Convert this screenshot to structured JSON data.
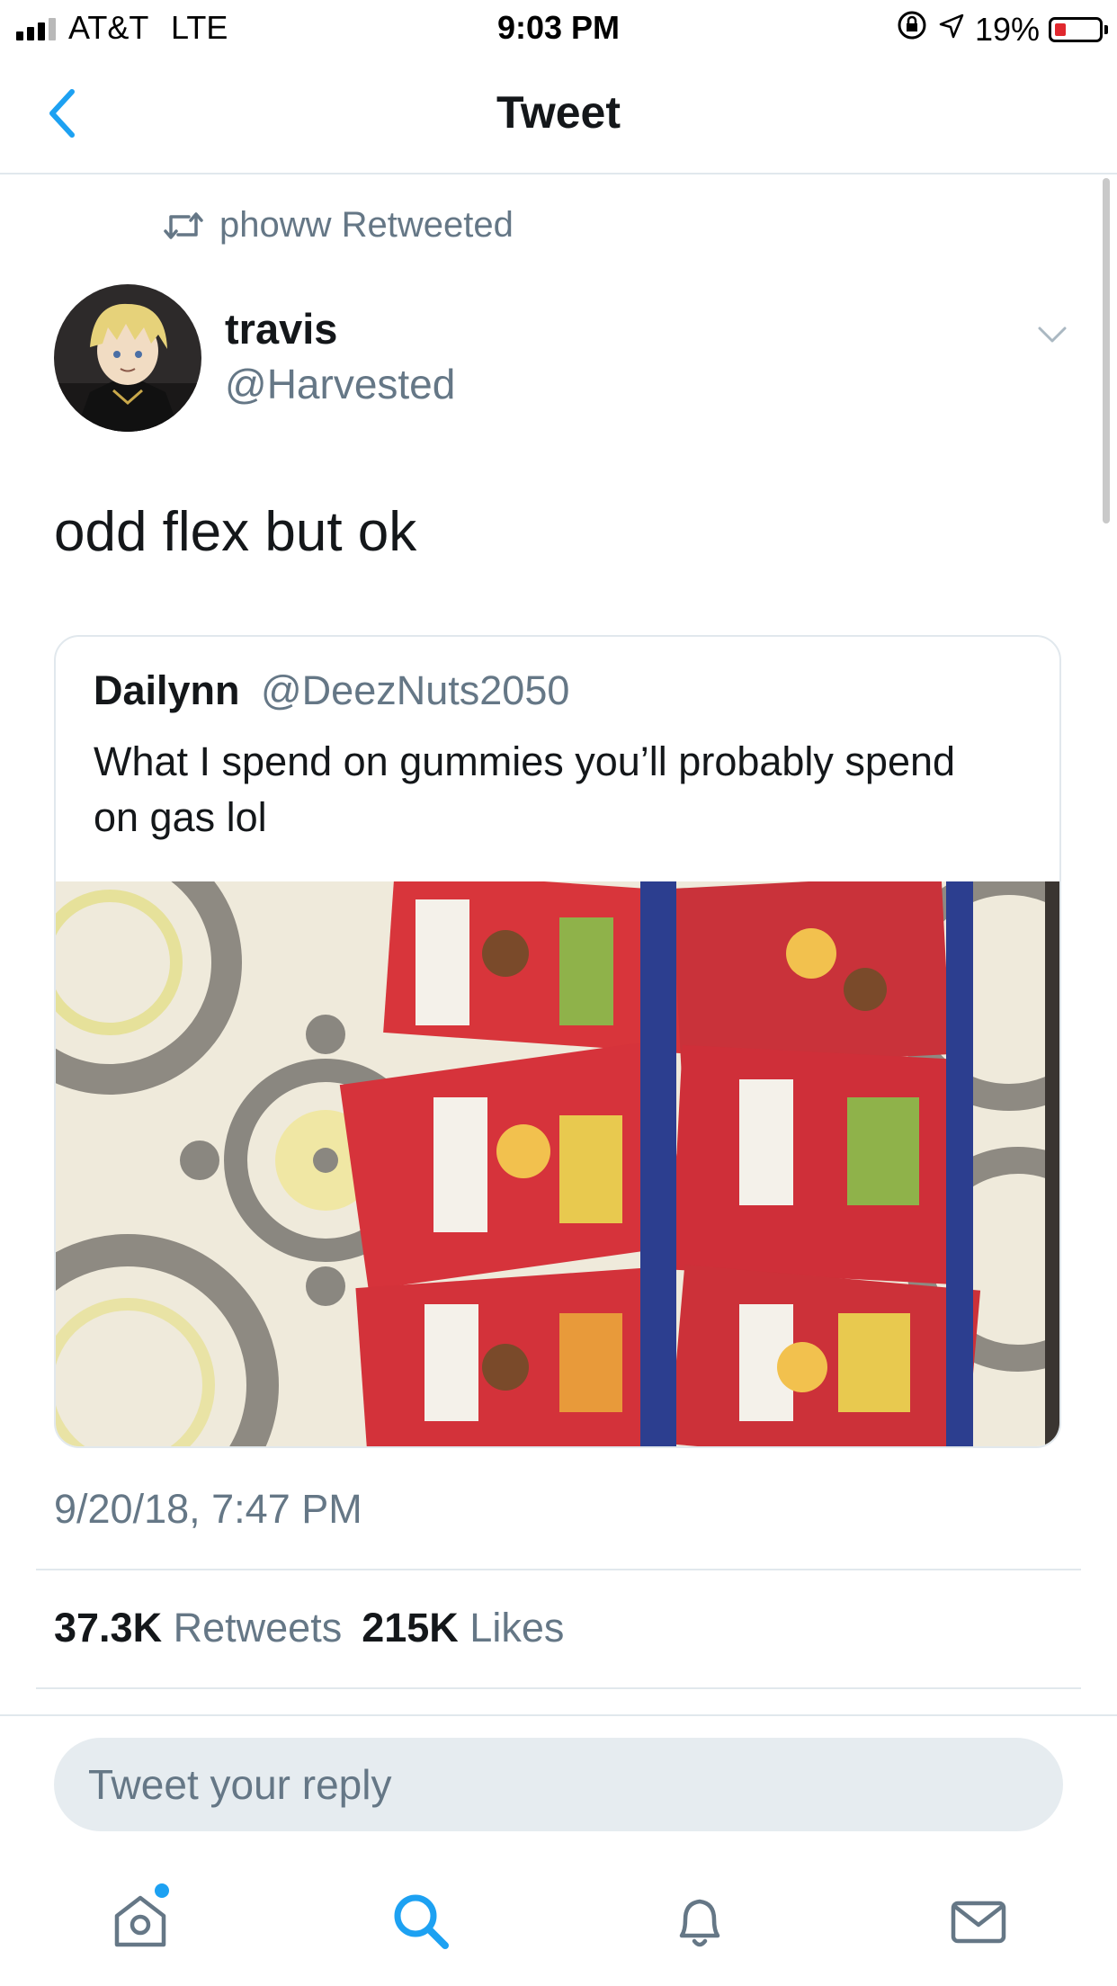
{
  "status_bar": {
    "carrier": "AT&T",
    "network": "LTE",
    "time": "9:03 PM",
    "battery": "19%"
  },
  "nav": {
    "title": "Tweet"
  },
  "retweet": {
    "label": "phoww Retweeted"
  },
  "tweet": {
    "name": "travis",
    "handle": "@Harvested",
    "text": "odd flex but ok",
    "timestamp": "9/20/18, 7:47 PM",
    "retweets_count": "37.3K",
    "retweets_label": "Retweets",
    "likes_count": "215K",
    "likes_label": "Likes"
  },
  "quoted_tweet": {
    "name": "Dailynn",
    "handle": "@DeezNuts2050",
    "text": "What I spend on gummies you’ll probably spend on gas lol"
  },
  "reply": {
    "placeholder": "Tweet your reply"
  },
  "tab_bar": {
    "items": [
      "home-icon",
      "search-icon",
      "bell-icon",
      "mail-icon"
    ],
    "active": "search-icon",
    "notification_dot": true
  },
  "colors": {
    "twitter_blue": "#1da1f2",
    "secondary_text": "#657786",
    "divider": "#e1e8ed",
    "battery_low": "#e0282e"
  }
}
